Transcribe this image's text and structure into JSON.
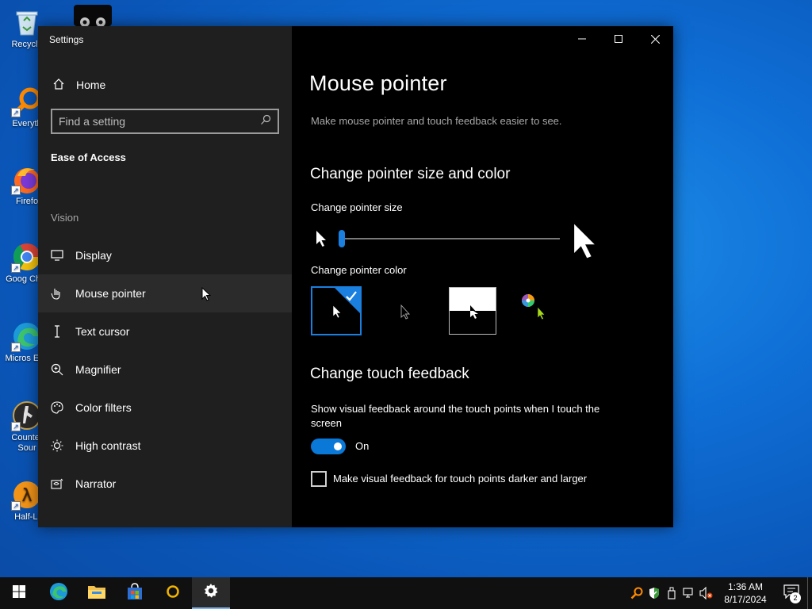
{
  "desktop": {
    "icons": [
      {
        "label": "Recycle",
        "icon": "recycle-bin-icon"
      },
      {
        "label": "Everyth",
        "icon": "everything-search-icon"
      },
      {
        "label": "Firefo",
        "icon": "firefox-icon"
      },
      {
        "label": "Goog Chro",
        "icon": "chrome-icon"
      },
      {
        "label": "Micros Edg",
        "icon": "edge-icon"
      },
      {
        "label": "Counter Sour",
        "icon": "counter-strike-icon"
      },
      {
        "label": "Half-Li",
        "icon": "half-life-icon"
      }
    ]
  },
  "window": {
    "title": "Settings",
    "sidebar": {
      "home_label": "Home",
      "search_placeholder": "Find a setting",
      "section_heading": "Ease of Access",
      "group_label": "Vision",
      "items": [
        {
          "label": "Display",
          "icon": "display-icon"
        },
        {
          "label": "Mouse pointer",
          "icon": "mouse-pointer-icon",
          "active": true
        },
        {
          "label": "Text cursor",
          "icon": "text-cursor-icon"
        },
        {
          "label": "Magnifier",
          "icon": "magnifier-icon"
        },
        {
          "label": "Color filters",
          "icon": "color-filters-icon"
        },
        {
          "label": "High contrast",
          "icon": "high-contrast-icon"
        },
        {
          "label": "Narrator",
          "icon": "narrator-icon"
        }
      ]
    },
    "content": {
      "title": "Mouse pointer",
      "description": "Make mouse pointer and touch feedback easier to see.",
      "pointer_section": "Change pointer size and color",
      "size_label": "Change pointer size",
      "size_value": 0,
      "color_label": "Change pointer color",
      "color_options": [
        "white",
        "black",
        "inverted",
        "custom"
      ],
      "selected_color": "white",
      "touch_section": "Change touch feedback",
      "touch_desc_line1": "Show visual feedback around the touch points when I touch the",
      "touch_desc_line2": "screen",
      "toggle_state": "On",
      "toggle_on": true,
      "checkbox_label": "Make visual feedback for touch points darker and larger",
      "checkbox_checked": false
    }
  },
  "taskbar": {
    "apps": [
      "start-icon",
      "edge-icon",
      "file-explorer-icon",
      "store-icon",
      "search-app-icon",
      "settings-icon"
    ],
    "time": "1:36 AM",
    "date": "8/17/2024",
    "notification_count": "2"
  },
  "colors": {
    "accent": "#0a78d7",
    "sidebar_bg": "#1f1f1f",
    "content_bg": "#000000",
    "taskbar_bg": "#101010"
  }
}
